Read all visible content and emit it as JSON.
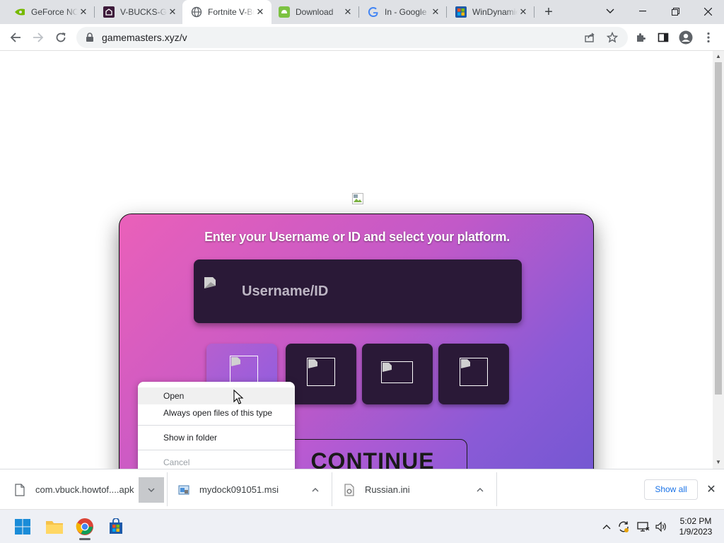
{
  "browser": {
    "tabs": [
      {
        "label": "GeForce NOW",
        "icon": "nvidia-icon",
        "active": false
      },
      {
        "label": "V-BUCKS-GENERATOR",
        "icon": "house-icon",
        "active": false
      },
      {
        "label": "Fortnite V-Bucks",
        "icon": "globe-icon",
        "active": true
      },
      {
        "label": "Download",
        "icon": "android-icon",
        "active": false
      },
      {
        "label": "In - Google",
        "icon": "google-icon",
        "active": false
      },
      {
        "label": "WinDynamic",
        "icon": "store-icon",
        "active": false
      }
    ],
    "url": "gamemasters.xyz/v"
  },
  "page": {
    "heading": "Enter your Username or ID and select your platform.",
    "username_placeholder": "Username/ID",
    "continue_label": "CONTINUE"
  },
  "context_menu": {
    "items": [
      {
        "label": "Open",
        "state": "hover"
      },
      {
        "label": "Always open files of this type",
        "state": "normal"
      },
      {
        "label": "Show in folder",
        "state": "normal"
      },
      {
        "label": "Cancel",
        "state": "disabled"
      }
    ]
  },
  "downloads": {
    "items": [
      {
        "name": "com.vbuck.howtof....apk",
        "icon": "file-icon"
      },
      {
        "name": "mydock091051.msi",
        "icon": "installer-icon"
      },
      {
        "name": "Russian.ini",
        "icon": "settings-file-icon"
      }
    ],
    "show_all_label": "Show all"
  },
  "taskbar": {
    "time": "5:02 PM",
    "date": "1/9/2023"
  },
  "colors": {
    "card_gradient_start": "#ea60b9",
    "card_gradient_end": "#6f57d1",
    "dark_panel": "#2a1937",
    "link_blue": "#1a73e8"
  }
}
